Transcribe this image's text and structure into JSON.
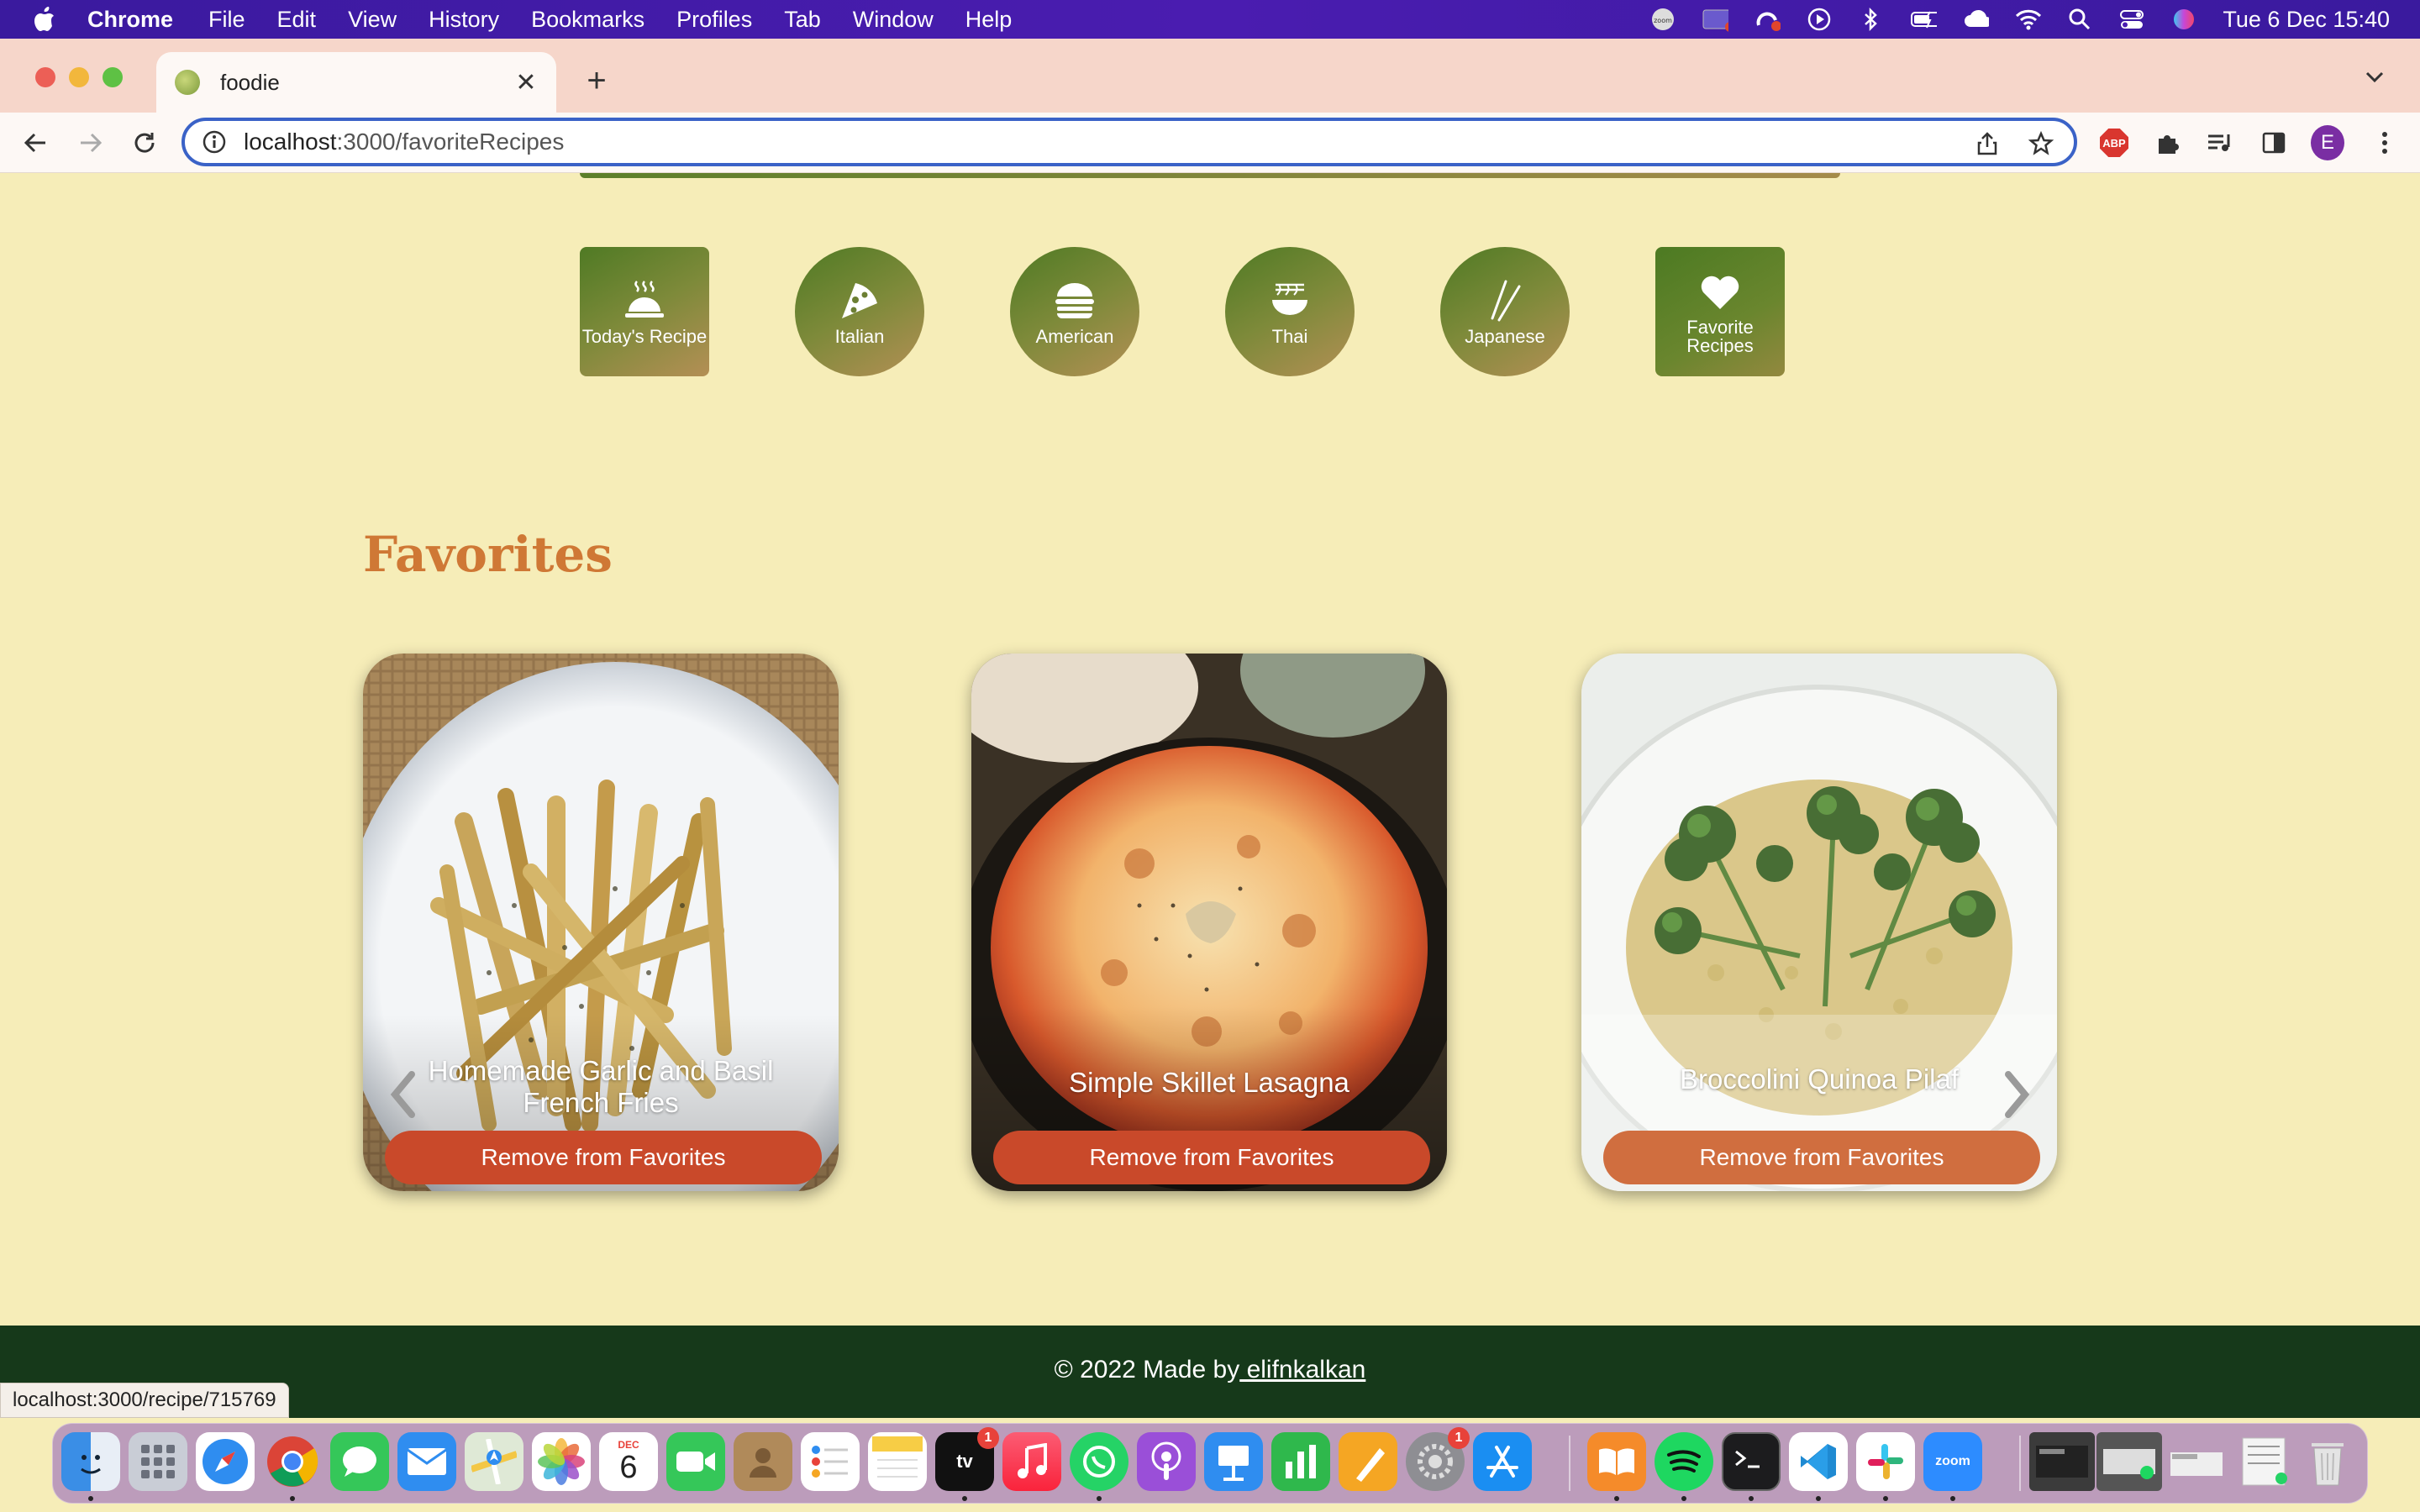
{
  "menubar": {
    "app_name": "Chrome",
    "items": [
      "File",
      "Edit",
      "View",
      "History",
      "Bookmarks",
      "Profiles",
      "Tab",
      "Window",
      "Help"
    ],
    "datetime": "Tue 6 Dec  15:40",
    "status_icons": [
      "zoom-icon",
      "recording-icon",
      "creative-cloud-icon",
      "play-icon",
      "bluetooth-icon",
      "battery-icon",
      "cloud-icon",
      "wifi-icon",
      "search-icon",
      "control-center-icon",
      "siri-icon"
    ]
  },
  "browser": {
    "tab_title": "foodie",
    "url_host": "localhost",
    "url_path": ":3000/favoriteRecipes",
    "profile_initial": "E",
    "abp_label": "ABP"
  },
  "categories": [
    {
      "label": "Today's Recipe",
      "icon": "food-cloche-icon",
      "shape": "square"
    },
    {
      "label": "Italian",
      "icon": "pizza-icon",
      "shape": "circle"
    },
    {
      "label": "American",
      "icon": "burger-icon",
      "shape": "circle"
    },
    {
      "label": "Thai",
      "icon": "noodle-bowl-icon",
      "shape": "circle"
    },
    {
      "label": "Japanese",
      "icon": "chopsticks-icon",
      "shape": "circle"
    },
    {
      "label": "Favorite\nRecipes",
      "icon": "heart-icon",
      "shape": "square"
    }
  ],
  "favorites": {
    "title": "Favorites",
    "cards": [
      {
        "title": "Homemade Garlic and Basil French Fries",
        "button": "Remove from Favorites"
      },
      {
        "title": "Simple Skillet Lasagna",
        "button": "Remove from Favorites"
      },
      {
        "title": "Broccolini Quinoa Pilaf",
        "button": "Remove from Favorites"
      }
    ]
  },
  "footer": {
    "copyright": "© 2022 Made by",
    "author": " elifnkalkan"
  },
  "status_bar": {
    "hover_url": "localhost:3000/recipe/715769"
  },
  "dock": {
    "calendar_month": "DEC",
    "calendar_day": "6",
    "apple_tv_badge": "1",
    "settings_badge": "1",
    "zoom_label": "zoom"
  },
  "colors": {
    "page_bg": "#f6edb8",
    "title_orange": "#cf7835",
    "button_red": "#c9492a",
    "footer_green": "#16391a",
    "category_green": "#5a7d28"
  }
}
